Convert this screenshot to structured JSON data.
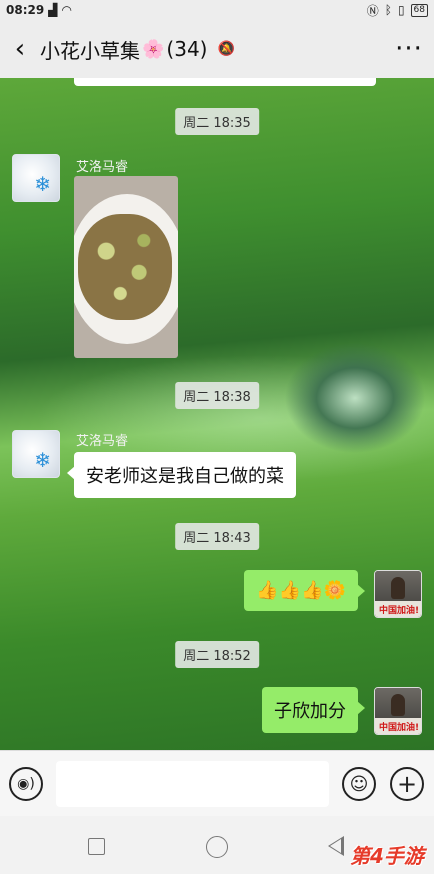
{
  "status_bar": {
    "time": "08:29",
    "battery": "68"
  },
  "header": {
    "title": "小花小草集",
    "title_emoji": "🌸",
    "member_count": "(34)",
    "back_icon": "‹",
    "more_icon": "···"
  },
  "messages": [
    {
      "type": "time",
      "text": "周二 18:35"
    },
    {
      "type": "incoming_image",
      "sender": "艾洛马睿",
      "image": "photo-of-cooked-dish"
    },
    {
      "type": "time",
      "text": "周二 18:38"
    },
    {
      "type": "incoming_text",
      "sender": "艾洛马睿",
      "text": "安老师这是我自己做的菜"
    },
    {
      "type": "time",
      "text": "周二 18:43"
    },
    {
      "type": "outgoing_text",
      "text": "👍👍👍🌼"
    },
    {
      "type": "time",
      "text": "周二 18:52"
    },
    {
      "type": "outgoing_text",
      "text": "子欣加分"
    }
  ],
  "avatar_right_banner": "中国加油!",
  "input_bar": {
    "placeholder": "",
    "plus_icon": "+"
  },
  "watermark": "第4手游",
  "colors": {
    "outgoing_bubble": "#95ec69",
    "incoming_bubble": "#ffffff",
    "header_bg": "#ededed"
  }
}
